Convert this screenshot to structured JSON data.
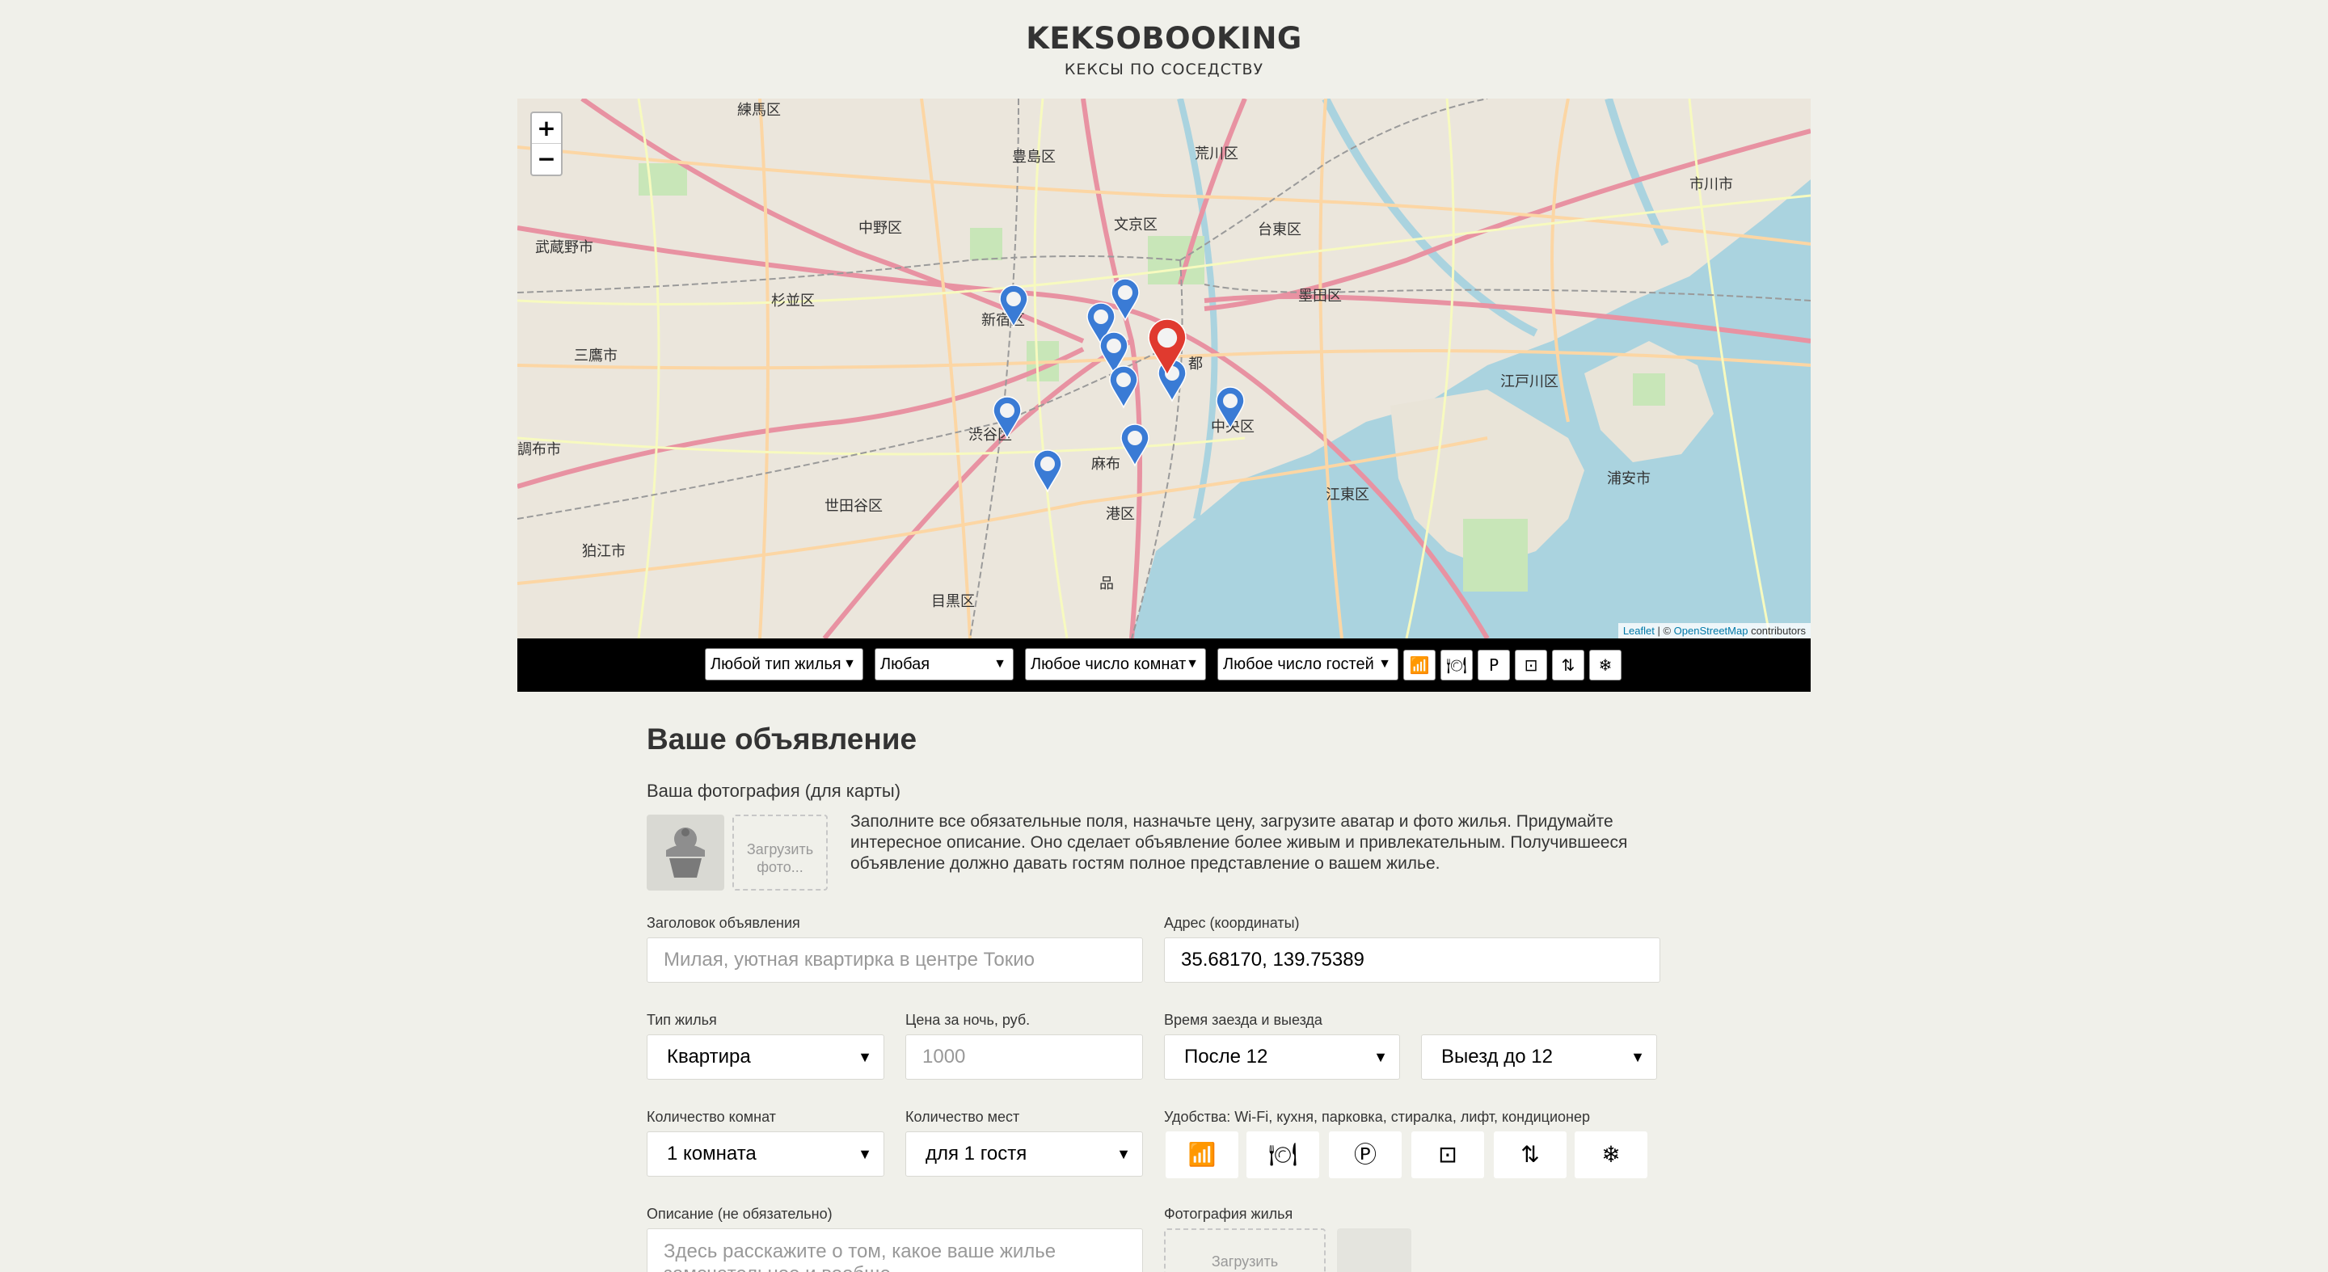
{
  "header": {
    "title": "KEKSOBOOKING",
    "subtitle": "КЕКСЫ ПО СОСЕДСТВУ"
  },
  "map": {
    "zoom_in": "+",
    "zoom_out": "−",
    "attribution_leaflet": "Leaflet",
    "attribution_sep": " | © ",
    "attribution_osm": "OpenStreetMap",
    "attribution_tail": " contributors",
    "labels": [
      "練馬区",
      "豊島区",
      "荒川区",
      "市川市",
      "中野区",
      "文京区",
      "台東区",
      "武蔵野市",
      "杉並区",
      "新宿区",
      "墨田区",
      "三鷹市",
      "都",
      "江戸川区",
      "渋谷区",
      "中央区",
      "調布市",
      "世田谷区",
      "港区",
      "浦安市",
      "江東区",
      "狛江市",
      "目黒区",
      "品",
      "麻布"
    ],
    "colors": {
      "pin_blue": "#3a7bd5",
      "pin_red": "#e03a2f",
      "water": "#aad3df"
    }
  },
  "filters": {
    "type": "Любой тип жилья",
    "price": "Любая",
    "rooms": "Любое число комнат",
    "guests": "Любое число гостей",
    "features": [
      "wifi-icon",
      "dishwasher-icon",
      "parking-icon",
      "washer-icon",
      "elevator-icon",
      "conditioner-icon"
    ]
  },
  "form": {
    "heading": "Ваше объявление",
    "avatar_label": "Ваша фотография (для карты)",
    "upload_photo": "Загрузить фото...",
    "note": "Заполните все обязательные поля, назначьте цену, загрузите аватар и фото жилья. Придумайте интересное описание. Оно сделает объявление более живым и привлекательным. Получившееся объявление должно давать гостям полное представление о вашем жилье.",
    "title_label": "Заголовок объявления",
    "title_placeholder": "Милая, уютная квартирка в центре Токио",
    "address_label": "Адрес (координаты)",
    "address_value": "35.68170, 139.75389",
    "type_label": "Тип жилья",
    "type_value": "Квартира",
    "price_label": "Цена за ночь, руб.",
    "price_placeholder": "1000",
    "time_label": "Время заезда и выезда",
    "checkin_value": "После 12",
    "checkout_value": "Выезд до 12",
    "rooms_label": "Количество комнат",
    "rooms_value": "1 комната",
    "capacity_label": "Количество мест",
    "capacity_value": "для 1 гостя",
    "features_label": "Удобства: Wi-Fi, кухня, парковка, стиралка, лифт, кондиционер",
    "description_label": "Описание (не обязательно)",
    "description_placeholder": "Здесь расскажите о том, какое ваше жилье замечательное и вообще",
    "photo_label": "Фотография жилья",
    "photo_upload": "Загрузить"
  }
}
